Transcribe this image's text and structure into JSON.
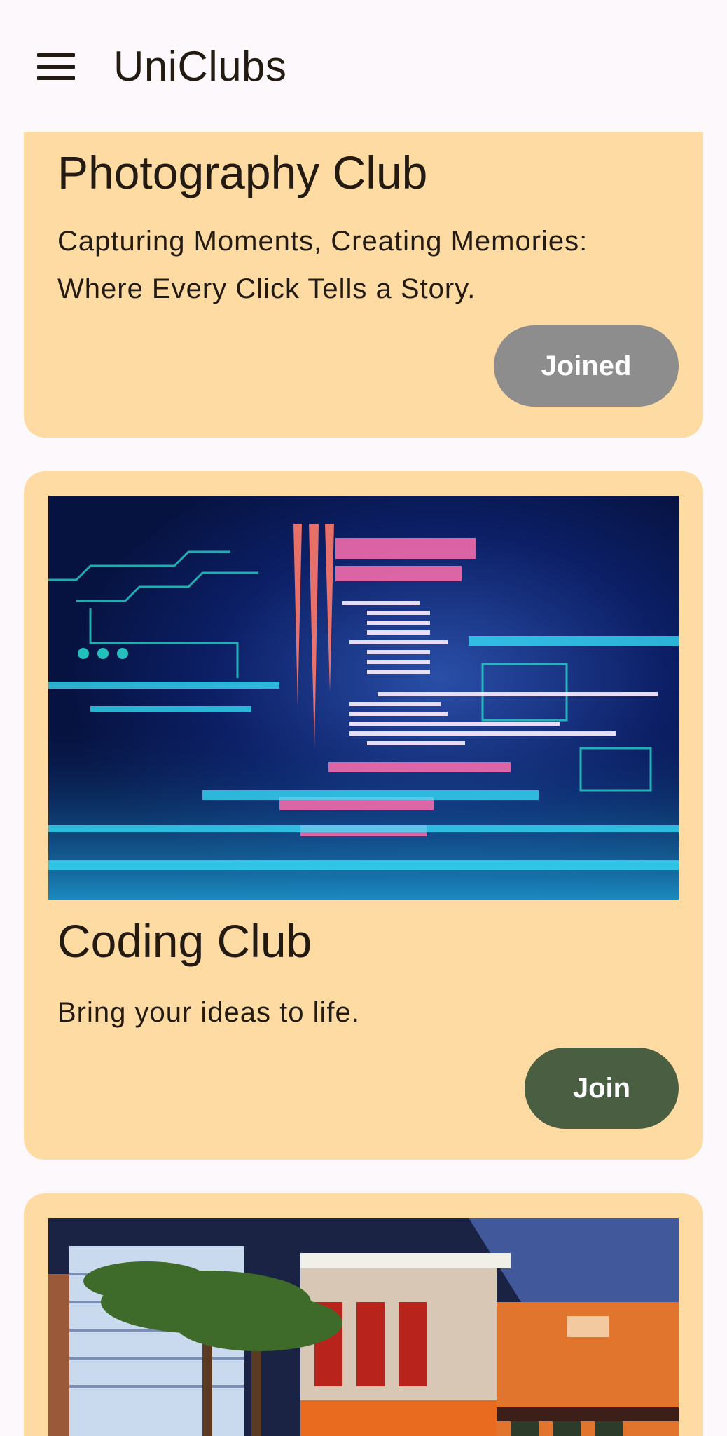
{
  "app_bar": {
    "title": "UniClubs",
    "menu_icon": "hamburger-menu-icon"
  },
  "clubs": [
    {
      "name": "Photography Club",
      "description": "Capturing Moments, Creating Memories: Where Every Click Tells a Story.",
      "button_label": "Joined",
      "joined": true
    },
    {
      "name": "Coding Club",
      "description": "Bring your ideas to life.",
      "button_label": "Join",
      "joined": false,
      "image": "code-screen-image"
    },
    {
      "image": "street-painting-image"
    }
  ],
  "colors": {
    "background": "#FCF8FB",
    "card": "#FDDBA2",
    "joined_button": "#8D8D8D",
    "join_button": "#4A5E42",
    "text": "#231A12"
  }
}
